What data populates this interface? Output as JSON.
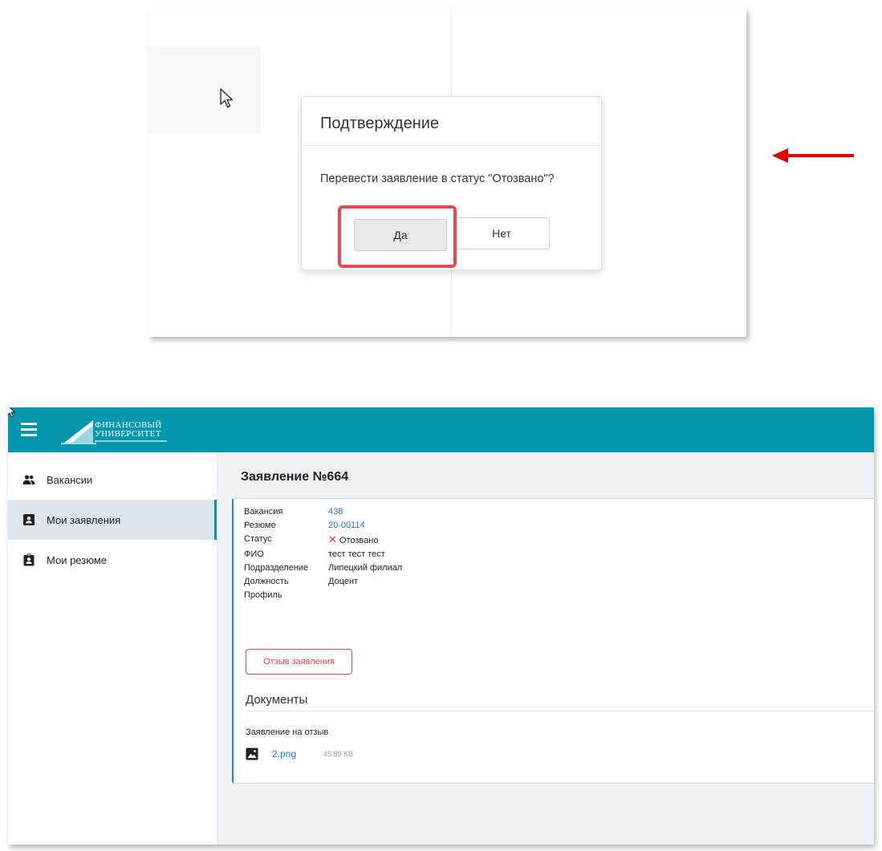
{
  "dialog": {
    "title": "Подтверждение",
    "message": "Перевести заявление в статус \"Отозвано\"?",
    "yes_label": "Да",
    "no_label": "Нет"
  },
  "annotation": {
    "highlight_color": "#e9474f",
    "arrow_color": "#e00000",
    "arrow_icon": "arrow-left-icon"
  },
  "app": {
    "brand_color": "#0497ad",
    "logo_line1": "ФИНАНСОВЫЙ",
    "logo_line2": "УНИВЕРСИТЕТ",
    "sidebar": {
      "items": [
        {
          "label": "Вакансии",
          "icon": "people-icon",
          "active": false
        },
        {
          "label": "Мои заявления",
          "icon": "contact-card-icon",
          "active": true
        },
        {
          "label": "Мои резюме",
          "icon": "clipboard-person-icon",
          "active": false
        }
      ]
    },
    "application": {
      "title": "Заявление №664",
      "fields": [
        {
          "label": "Вакансия",
          "value": "438",
          "link": true
        },
        {
          "label": "Резюме",
          "value": "20-00114",
          "link": true
        },
        {
          "label": "Статус",
          "value": "Отозвано",
          "status_icon": "x-icon",
          "status_color": "#e53935"
        },
        {
          "label": "ФИО",
          "value": "тест тест тест"
        },
        {
          "label": "Подразделение",
          "value": "Липецкий филиал"
        },
        {
          "label": "Должность",
          "value": "Доцент"
        },
        {
          "label": "Профиль",
          "value": ""
        }
      ],
      "withdraw_button": "Отзыв заявления",
      "documents_title": "Документы",
      "document_group_label": "Заявление на отзыв",
      "file": {
        "name": "2.png",
        "size": "45.89 KB",
        "icon": "image-file-icon"
      }
    }
  }
}
